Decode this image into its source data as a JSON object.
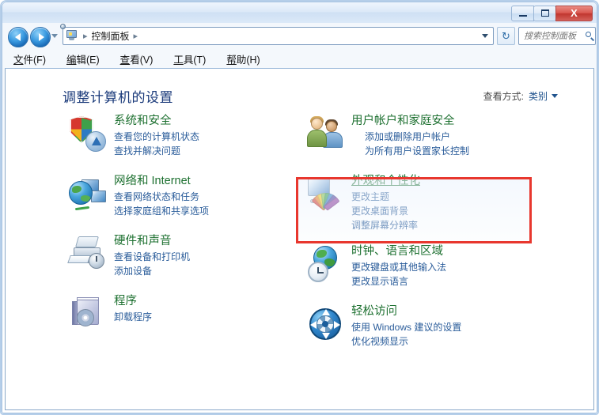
{
  "window": {
    "titlebar": {
      "minimize_label": "最小化",
      "maximize_label": "最大化",
      "close_label": "X"
    }
  },
  "addressbar": {
    "root_icon": "control-panel-icon",
    "crumbs": [
      "控制面板"
    ],
    "separator": "▸",
    "dropdown_icon": "chevron-down-icon",
    "refresh_icon": "refresh-icon",
    "refresh_glyph": "↻"
  },
  "search": {
    "placeholder": "搜索控制面板",
    "value": "",
    "icon": "search-icon"
  },
  "menubar": {
    "items": [
      {
        "accel": "文",
        "rest": "件(F)"
      },
      {
        "accel": "编",
        "rest": "辑(E)"
      },
      {
        "accel": "查",
        "rest": "看(V)"
      },
      {
        "accel": "工",
        "rest": "具(T)"
      },
      {
        "accel": "帮",
        "rest": "助(H)"
      }
    ]
  },
  "page": {
    "header": "调整计算机的设置",
    "viewby_label": "查看方式:",
    "viewby_value": "类别"
  },
  "categories": {
    "left": [
      {
        "icon": "system-security-icon",
        "title": "系统和安全",
        "links": [
          {
            "text": "查看您的计算机状态",
            "shield": false
          },
          {
            "text": "查找并解决问题",
            "shield": false
          }
        ]
      },
      {
        "icon": "network-internet-icon",
        "title": "网络和 Internet",
        "links": [
          {
            "text": "查看网络状态和任务",
            "shield": false
          },
          {
            "text": "选择家庭组和共享选项",
            "shield": false
          }
        ]
      },
      {
        "icon": "hardware-sound-icon",
        "title": "硬件和声音",
        "links": [
          {
            "text": "查看设备和打印机",
            "shield": false
          },
          {
            "text": "添加设备",
            "shield": false
          }
        ]
      },
      {
        "icon": "programs-icon",
        "title": "程序",
        "links": [
          {
            "text": "卸载程序",
            "shield": false
          }
        ]
      }
    ],
    "right": [
      {
        "icon": "user-accounts-icon",
        "title": "用户帐户和家庭安全",
        "links": [
          {
            "text": "添加或删除用户帐户",
            "shield": true
          },
          {
            "text": "为所有用户设置家长控制",
            "shield": true
          }
        ]
      },
      {
        "icon": "appearance-personalization-icon",
        "title": "外观和个性化",
        "hover": true,
        "links": [
          {
            "text": "更改主题",
            "shield": false
          },
          {
            "text": "更改桌面背景",
            "shield": false
          },
          {
            "text": "调整屏幕分辨率",
            "shield": false
          }
        ]
      },
      {
        "icon": "clock-language-region-icon",
        "title": "时钟、语言和区域",
        "links": [
          {
            "text": "更改键盘或其他输入法",
            "shield": false
          },
          {
            "text": "更改显示语言",
            "shield": false
          }
        ]
      },
      {
        "icon": "ease-of-access-icon",
        "title": "轻松访问",
        "links": [
          {
            "text": "使用 Windows 建议的设置",
            "shield": false
          },
          {
            "text": "优化视频显示",
            "shield": false
          }
        ]
      }
    ]
  },
  "annotation": {
    "highlight_color": "#e8372e",
    "highlight_target": "外观和个性化"
  },
  "colors": {
    "category_title": "#1d7030",
    "link": "#2a5c9a",
    "header": "#1a3a7a",
    "accent": "#e8372e"
  }
}
